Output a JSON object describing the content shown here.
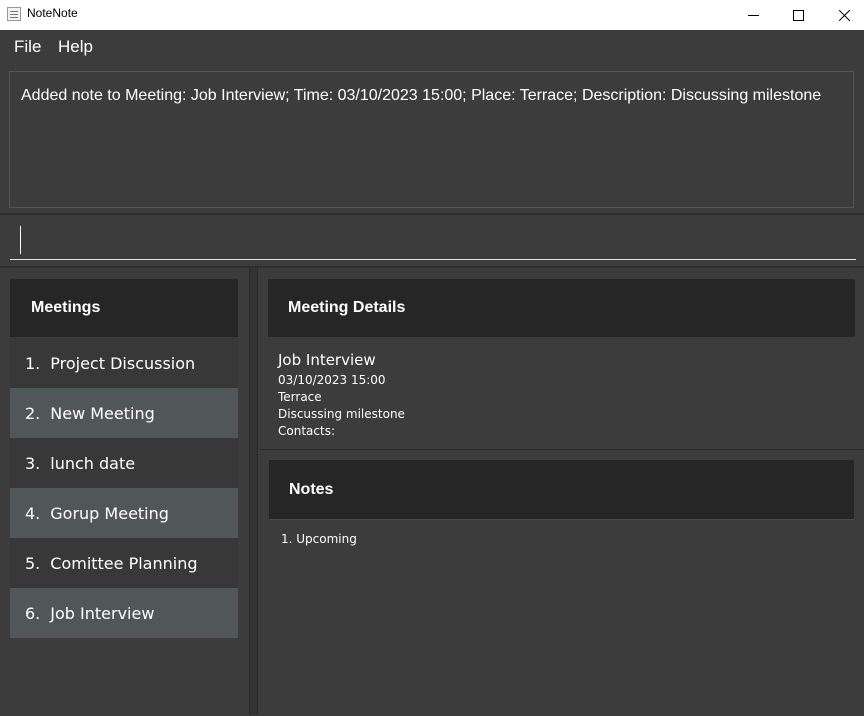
{
  "window": {
    "title": "NoteNote",
    "icon": "notebook-icon"
  },
  "menu": {
    "file_label": "File",
    "help_label": "Help"
  },
  "result": {
    "text": "Added note to Meeting: Job Interview; Time: 03/10/2023 15:00; Place: Terrace; Description: Discussing milestone"
  },
  "command": {
    "value": "",
    "placeholder": ""
  },
  "meetings": {
    "title": "Meetings",
    "items": [
      {
        "num": "1.",
        "label": "Project Discussion"
      },
      {
        "num": "2.",
        "label": "New Meeting"
      },
      {
        "num": "3.",
        "label": "lunch date"
      },
      {
        "num": "4.",
        "label": "Gorup Meeting"
      },
      {
        "num": "5.",
        "label": "Comittee Planning"
      },
      {
        "num": "6.",
        "label": "Job Interview"
      }
    ]
  },
  "details": {
    "title": "Meeting Details",
    "name": "Job Interview",
    "time": "03/10/2023 15:00",
    "place": "Terrace",
    "description": "Discussing milestone",
    "contacts": "Contacts:"
  },
  "notes": {
    "title": "Notes",
    "items": [
      "1. Upcoming"
    ]
  },
  "colors": {
    "background": "#3c3c3c",
    "header": "#262626",
    "list_odd": "#383838",
    "list_even": "#515658",
    "text": "#ffffff"
  }
}
